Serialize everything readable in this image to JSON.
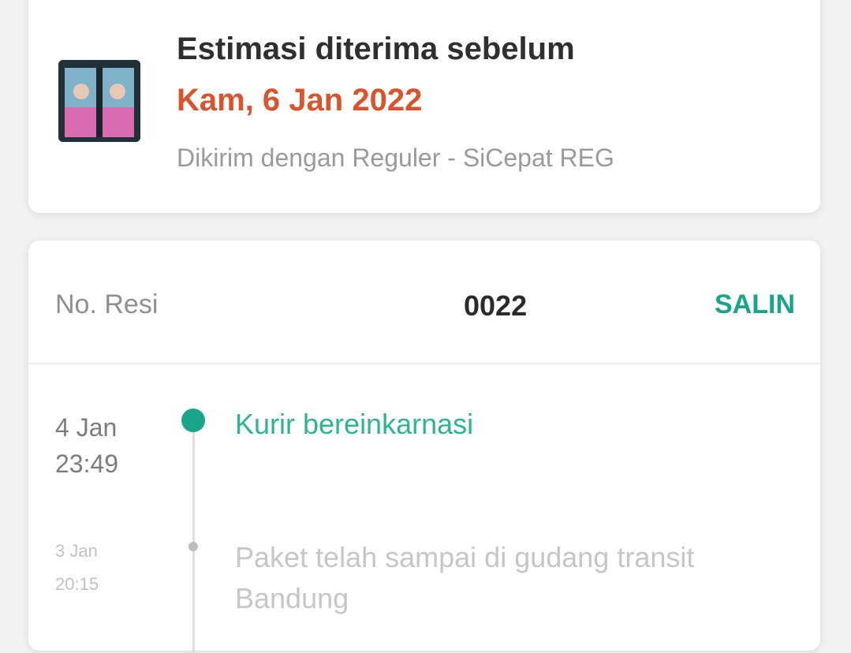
{
  "estimate": {
    "title": "Estimasi diterima sebelum",
    "date": "Kam, 6 Jan 2022",
    "courier": "Dikirim dengan Reguler - SiCepat REG",
    "date_color": "#d9532c"
  },
  "tracking": {
    "resi_label": "No. Resi",
    "resi_number": "0022",
    "copy_label": "SALIN",
    "accent_color": "#1aa58a",
    "events": [
      {
        "date": "4 Jan",
        "time": "23:49",
        "text": "Kurir bereinkarnasi"
      },
      {
        "date": "3 Jan",
        "time": "20:15",
        "text": "Paket telah sampai di gudang transit Bandung"
      }
    ]
  }
}
